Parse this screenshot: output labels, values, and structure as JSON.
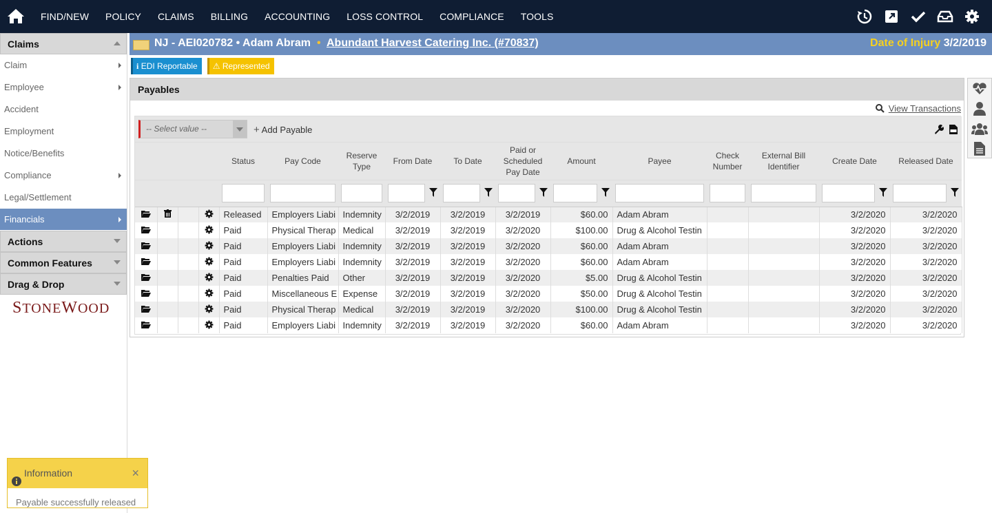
{
  "nav": {
    "home_icon": "home-icon",
    "items": [
      "FIND/NEW",
      "POLICY",
      "CLAIMS",
      "BILLING",
      "ACCOUNTING",
      "LOSS CONTROL",
      "COMPLIANCE",
      "TOOLS"
    ],
    "right_icons": [
      "history-icon",
      "external-link-icon",
      "checkmark-icon",
      "inbox-icon",
      "gear-icon"
    ],
    "background": "#0f1d33"
  },
  "sidebar": {
    "header": "Claims",
    "items": [
      {
        "label": "Claim",
        "has_submenu": true
      },
      {
        "label": "Employee",
        "has_submenu": true
      },
      {
        "label": "Accident",
        "has_submenu": false
      },
      {
        "label": "Employment",
        "has_submenu": false
      },
      {
        "label": "Notice/Benefits",
        "has_submenu": false
      },
      {
        "label": "Compliance",
        "has_submenu": true
      },
      {
        "label": "Legal/Settlement",
        "has_submenu": false
      },
      {
        "label": "Financials",
        "has_submenu": true,
        "active": true
      }
    ],
    "sections": [
      "Actions",
      "Common Features",
      "Drag & Drop"
    ],
    "logo_text": "STONEWOOD",
    "active_color": "#6c8ebf"
  },
  "infobar": {
    "title": "NJ - AEI020782 • Adam Abram",
    "separator": "•",
    "company": "Abundant Harvest Catering Inc. (#70837)",
    "doi_label": "Date of Injury",
    "doi_value": "3/2/2019",
    "background": "#6c8ebf"
  },
  "badges": {
    "edi": "EDI Reportable",
    "represented": "Represented"
  },
  "right_tabs": [
    "heartbeat-icon",
    "user-icon",
    "users-icon",
    "document-icon"
  ],
  "payables": {
    "title": "Payables",
    "view_transactions": "View Transactions",
    "select_placeholder": "-- Select value --",
    "add_payable": "Add Payable",
    "columns": [
      "Status",
      "Pay Code",
      "Reserve Type",
      "From Date",
      "To Date",
      "Paid or Scheduled Pay Date",
      "Amount",
      "Payee",
      "Check Number",
      "External Bill Identifier",
      "Create Date",
      "Released Date"
    ],
    "rows": [
      {
        "delete": true,
        "status": "Released",
        "pay_code": "Employers Liabi",
        "reserve_type": "Indemnity",
        "from": "3/2/2019",
        "to": "3/2/2019",
        "paid": "3/2/2019",
        "amount": "$60.00",
        "payee": "Adam Abram",
        "check": "",
        "ext": "",
        "create": "3/2/2020",
        "released": "3/2/2020"
      },
      {
        "delete": false,
        "status": "Paid",
        "pay_code": "Physical Therap",
        "reserve_type": "Medical",
        "from": "3/2/2019",
        "to": "3/2/2019",
        "paid": "3/2/2020",
        "amount": "$100.00",
        "payee": "Drug & Alcohol Testin",
        "check": "",
        "ext": "",
        "create": "3/2/2020",
        "released": "3/2/2020"
      },
      {
        "delete": false,
        "status": "Paid",
        "pay_code": "Employers Liabi",
        "reserve_type": "Indemnity",
        "from": "3/2/2019",
        "to": "3/2/2019",
        "paid": "3/2/2020",
        "amount": "$60.00",
        "payee": "Adam Abram",
        "check": "",
        "ext": "",
        "create": "3/2/2020",
        "released": "3/2/2020"
      },
      {
        "delete": false,
        "status": "Paid",
        "pay_code": "Employers Liabi",
        "reserve_type": "Indemnity",
        "from": "3/2/2019",
        "to": "3/2/2019",
        "paid": "3/2/2020",
        "amount": "$60.00",
        "payee": "Adam Abram",
        "check": "",
        "ext": "",
        "create": "3/2/2020",
        "released": "3/2/2020"
      },
      {
        "delete": false,
        "status": "Paid",
        "pay_code": "Penalties Paid",
        "reserve_type": "Other",
        "from": "3/2/2019",
        "to": "3/2/2019",
        "paid": "3/2/2020",
        "amount": "$5.00",
        "payee": "Drug & Alcohol Testin",
        "check": "",
        "ext": "",
        "create": "3/2/2020",
        "released": "3/2/2020"
      },
      {
        "delete": false,
        "status": "Paid",
        "pay_code": "Miscellaneous E",
        "reserve_type": "Expense",
        "from": "3/2/2019",
        "to": "3/2/2019",
        "paid": "3/2/2020",
        "amount": "$50.00",
        "payee": "Drug & Alcohol Testin",
        "check": "",
        "ext": "",
        "create": "3/2/2020",
        "released": "3/2/2020"
      },
      {
        "delete": false,
        "status": "Paid",
        "pay_code": "Physical Therap",
        "reserve_type": "Medical",
        "from": "3/2/2019",
        "to": "3/2/2019",
        "paid": "3/2/2020",
        "amount": "$100.00",
        "payee": "Drug & Alcohol Testin",
        "check": "",
        "ext": "",
        "create": "3/2/2020",
        "released": "3/2/2020"
      },
      {
        "delete": false,
        "status": "Paid",
        "pay_code": "Employers Liabi",
        "reserve_type": "Indemnity",
        "from": "3/2/2019",
        "to": "3/2/2019",
        "paid": "3/2/2020",
        "amount": "$60.00",
        "payee": "Adam Abram",
        "check": "",
        "ext": "",
        "create": "3/2/2020",
        "released": "3/2/2020"
      }
    ]
  },
  "toast": {
    "title": "Information",
    "message": "Payable successfully released",
    "close": "×",
    "color": "#f5d24a"
  }
}
